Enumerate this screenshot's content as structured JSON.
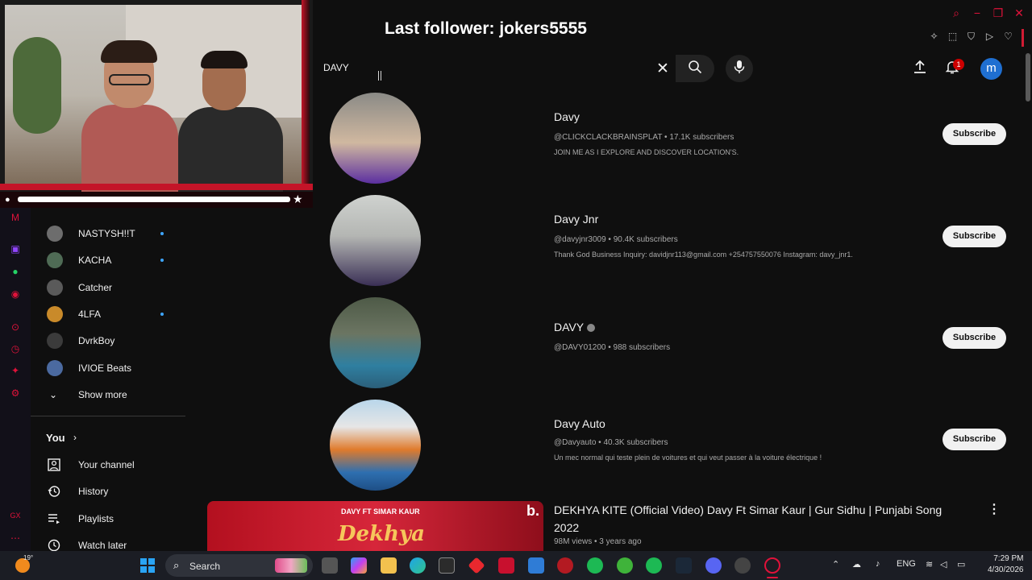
{
  "overlay": {
    "last_follower": "Last follower: jokers5555"
  },
  "search": {
    "query": "DAVY"
  },
  "header": {
    "notification_count": "1",
    "avatar_letter": "m"
  },
  "sidebar": {
    "subscriptions": [
      {
        "label": "NASTYSH!!T",
        "live": true,
        "color": "#6d6d6d"
      },
      {
        "label": "KACHA",
        "live": true,
        "color": "#4f6b55"
      },
      {
        "label": "Catcher",
        "live": false,
        "color": "#5a5a5a"
      },
      {
        "label": "4LFA",
        "live": true,
        "color": "#c98a2a"
      },
      {
        "label": "DvrkBoy",
        "live": false,
        "color": "#3b3b3b"
      },
      {
        "label": "IVIOE Beats",
        "live": false,
        "color": "#4b6aa0"
      }
    ],
    "show_more": "Show more",
    "you_label": "You",
    "you_items": [
      {
        "label": "Your channel",
        "icon": "your-channel-icon"
      },
      {
        "label": "History",
        "icon": "history-icon"
      },
      {
        "label": "Playlists",
        "icon": "playlists-icon"
      },
      {
        "label": "Watch later",
        "icon": "watch-later-icon"
      }
    ]
  },
  "results": [
    {
      "name": "Davy",
      "meta": "@CLICKCLACKBRAINSPLAT • 17.1K subscribers",
      "desc": "JOIN ME AS I EXPLORE AND DISCOVER LOCATION'S.",
      "verified": false,
      "subscribe": "Subscribe"
    },
    {
      "name": "Davy Jnr",
      "meta": "@davyjnr3009 • 90.4K subscribers",
      "desc": "Thank God Business Inquiry: davidjnr113@gmail.com +254757550076 Instagram: davy_jnr1.",
      "verified": false,
      "subscribe": "Subscribe"
    },
    {
      "name": "DAVY",
      "meta": "@DAVY01200 • 988 subscribers",
      "desc": "",
      "verified": true,
      "subscribe": "Subscribe"
    },
    {
      "name": "Davy Auto",
      "meta": "@Davyauto • 40.3K subscribers",
      "desc": "Un mec normal qui teste plein de voitures et qui veut passer à la voiture électrique !",
      "verified": false,
      "subscribe": "Subscribe"
    }
  ],
  "video": {
    "title": "DEKHYA KITE (Official Video) Davy Ft Simar Kaur | Gur Sidhu | Punjabi Song 2022",
    "meta": "98M views • 3 years ago",
    "thumb_caption": "DAVY FT SIMAR KAUR",
    "thumb_title": "Dekhya",
    "thumb_logo": "b."
  },
  "taskbar": {
    "temperature": "19°",
    "search_label": "Search",
    "language": "ENG",
    "time": "7:29 PM",
    "date": "4/30/2026"
  }
}
